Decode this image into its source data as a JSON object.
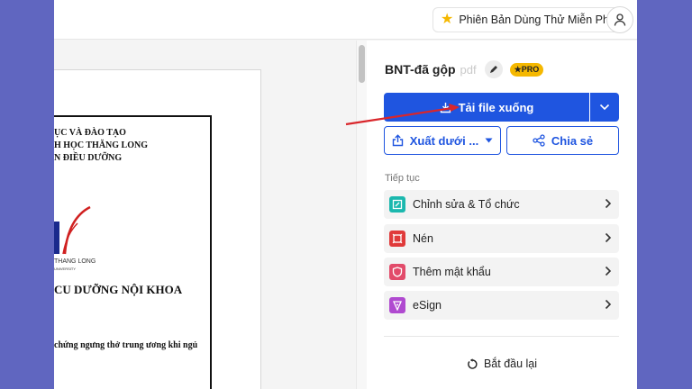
{
  "header": {
    "trial_label": "Phiên Bản Dùng Thử Miễn Phí",
    "star_icon": "star-icon",
    "user_icon": "user-icon"
  },
  "document": {
    "lines": [
      "ỤC VÀ ĐÀO TẠO",
      "H HỌC THĂNG LONG",
      "N ĐIỀU DƯỠNG",
      "CU DƯỠNG NỘI KHOA",
      "chứng ngưng thở trung ương khi ngủ"
    ],
    "logo_text": "THANG LONG",
    "logo_sub": "UNIVERSITY"
  },
  "panel": {
    "file_name": "BNT-đã gộp",
    "file_ext": "pdf",
    "pro_badge": "PRO",
    "download_label": "Tải file xuống",
    "export_label": "Xuất dưới ...",
    "share_label": "Chia sẻ",
    "section_label": "Tiếp tục",
    "actions": [
      {
        "label": "Chỉnh sửa & Tổ chức",
        "color": "#1bb8ae"
      },
      {
        "label": "Nén",
        "color": "#e03a3a"
      },
      {
        "label": "Thêm mật khẩu",
        "color": "#e24b6a"
      },
      {
        "label": "eSign",
        "color": "#b04ad0"
      }
    ],
    "restart_label": "Bắt đầu lại"
  },
  "colors": {
    "accent": "#1f55e0",
    "background": "#6066c0",
    "arrow": "#d9262b"
  }
}
